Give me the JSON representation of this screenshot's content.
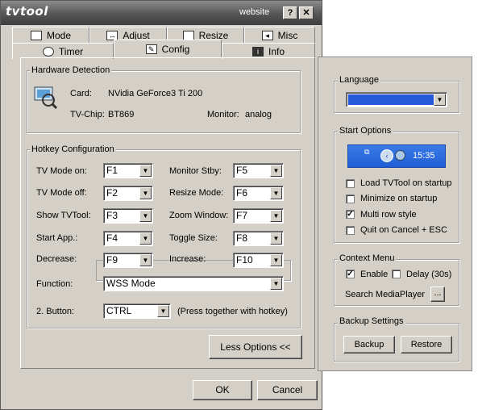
{
  "window": {
    "app_title": "tvtool",
    "website_link": "website",
    "help_button": "?",
    "close_button": "✕"
  },
  "tabs": {
    "top_row": [
      {
        "label": "Mode",
        "icon": "monitor-icon"
      },
      {
        "label": "Adjust",
        "icon": "adjust-icon"
      },
      {
        "label": "Resize",
        "icon": "resize-icon"
      },
      {
        "label": "Misc",
        "icon": "speaker-icon"
      }
    ],
    "bottom_row": [
      {
        "label": "Timer",
        "icon": "clock-icon"
      },
      {
        "label": "Config",
        "icon": "wrench-icon",
        "active": true
      },
      {
        "label": "Info",
        "icon": "info-icon"
      }
    ]
  },
  "hardware": {
    "title": "Hardware Detection",
    "card_label": "Card:",
    "card_value": "NVidia GeForce3 Ti 200",
    "chip_label": "TV-Chip:",
    "chip_value": "BT869",
    "monitor_label": "Monitor:",
    "monitor_value": "analog"
  },
  "hotkeys": {
    "title": "Hotkey Configuration",
    "tv_mode_on": {
      "label": "TV Mode on:",
      "value": "F1"
    },
    "tv_mode_off": {
      "label": "TV Mode off:",
      "value": "F2"
    },
    "show_tvtool": {
      "label": "Show TVTool:",
      "value": "F3"
    },
    "start_app": {
      "label": "Start App.:",
      "value": "F4"
    },
    "decrease": {
      "label": "Decrease:",
      "value": "F9"
    },
    "monitor_stby": {
      "label": "Monitor Stby:",
      "value": "F5"
    },
    "resize_mode": {
      "label": "Resize Mode:",
      "value": "F6"
    },
    "zoom_window": {
      "label": "Zoom Window:",
      "value": "F7"
    },
    "toggle_size": {
      "label": "Toggle Size:",
      "value": "F8"
    },
    "increase": {
      "label": "Increase:",
      "value": "F10"
    },
    "function_label": "Function:",
    "function_value": "WSS Mode",
    "button2_label": "2. Button:",
    "button2_value": "CTRL",
    "button2_hint": "(Press together with hotkey)"
  },
  "buttons": {
    "less_options": "Less Options <<",
    "ok": "OK",
    "cancel": "Cancel",
    "backup": "Backup",
    "restore": "Restore",
    "browse": "..."
  },
  "side": {
    "language_title": "Language",
    "language_value": "",
    "language_color": "#2458d8",
    "start_options_title": "Start Options",
    "tray_time": "15:35",
    "load_on_startup": {
      "label": "Load TVTool on startup",
      "checked": false
    },
    "minimize_on_startup": {
      "label": "Minimize on startup",
      "checked": false
    },
    "multi_row_style": {
      "label": "Multi row style",
      "checked": true
    },
    "quit_on_cancel": {
      "label": "Quit on Cancel + ESC",
      "checked": false
    },
    "context_menu_title": "Context Menu",
    "enable": {
      "label": "Enable",
      "checked": true
    },
    "delay": {
      "label": "Delay (30s)",
      "checked": false
    },
    "search_mediaplayer": "Search MediaPlayer",
    "backup_title": "Backup Settings"
  },
  "check_mark": "✓",
  "colors": {
    "dialog_bg": "#d4d0c8",
    "titlebar": "#555555",
    "selection_blue": "#2458d8"
  }
}
